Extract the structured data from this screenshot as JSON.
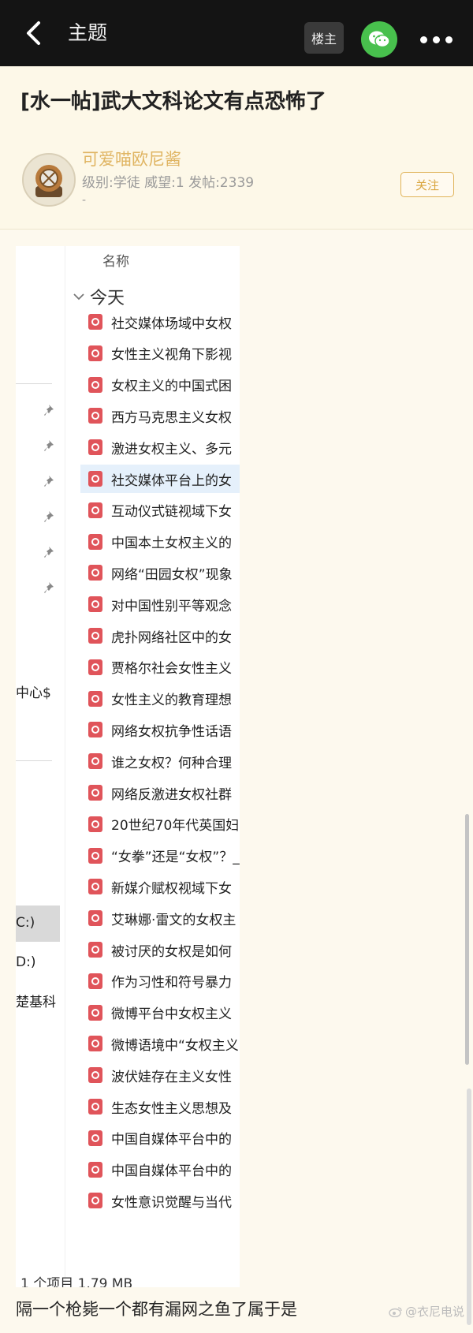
{
  "topbar": {
    "title": "主题",
    "louzhu_label": "楼主",
    "back_icon": "chevron-left-icon",
    "share_icon": "wechat-icon",
    "more_icon": "more-horizontal-icon"
  },
  "post": {
    "title": "[水一帖]武大文科论文有点恐怖了"
  },
  "author": {
    "name": "可爱喵欧尼酱",
    "meta": "级别:学徒 威望:1 发帖:2339",
    "dash": "-",
    "follow_label": "关注"
  },
  "screenshot": {
    "column_header": "名称",
    "group_label": "今天",
    "left_labels": [
      "中心$",
      "C:)",
      "D:)",
      "楚基科"
    ],
    "files": [
      "社交媒体场域中女权",
      "女性主义视角下影视",
      "女权主义的中国式困",
      "西方马克思主义女权",
      "激进女权主义、多元",
      "社交媒体平台上的女",
      "互动仪式链视域下女",
      "中国本土女权主义的",
      "网络“田园女权”现象",
      "对中国性别平等观念",
      "虎扑网络社区中的女",
      "贾格尔社会女性主义",
      "女性主义的教育理想",
      "网络女权抗争性话语",
      "谁之女权？何种合理",
      "网络反激进女权社群",
      "20世纪70年代英国妇",
      "“女拳”还是“女权”？_",
      "新媒介赋权视域下女",
      "艾琳娜·雷文的女权主",
      "被讨厌的女权是如何",
      "作为习性和符号暴力",
      "微博平台中女权主义",
      "微博语境中“女权主义",
      "波伏娃存在主义女性",
      "生态女性主义思想及",
      "中国自媒体平台中的",
      "中国自媒体平台中的",
      "女性意识觉醒与当代"
    ],
    "selected_index": 5,
    "status": "1 个项目  1.79 MB"
  },
  "caption": "隔一个枪毙一个都有漏网之鱼了属于是",
  "watermark": "@衣尼电说"
}
